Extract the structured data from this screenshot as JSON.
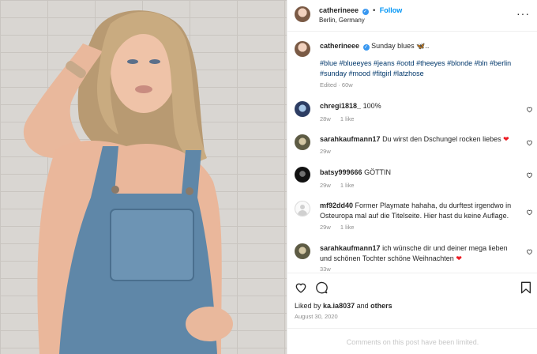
{
  "post": {
    "username": "catherineee",
    "verified_mark": "✓",
    "separator": "•",
    "follow_label": "Follow",
    "location": "Berlin, Germany",
    "more_icon": "more-horizontal-icon",
    "caption_text": "Sunday blues",
    "caption_emoji": "🦋",
    "caption_tail": "..",
    "hashtags": "#blue #blueeyes #jeans #ootd #theeyes #blonde #bln #berlin #sunday #mood #fitgirl #latzhose",
    "edited": "Edited · 60w"
  },
  "comments": [
    {
      "user": "chregi1818_",
      "text": "100%",
      "time": "28w",
      "likes": "1 like",
      "avatar": "blue"
    },
    {
      "user": "sarahkaufmann17",
      "text": "Du wirst den Dschungel rocken liebes",
      "emoji": "❤",
      "time": "29w",
      "avatar": "olive"
    },
    {
      "user": "batsy999666",
      "text": "GÖTTIN",
      "time": "29w",
      "likes": "1 like",
      "avatar": "dark"
    },
    {
      "user": "mf92dd40",
      "text": "Former Playmate hahaha, du durftest irgendwo in Osteuropa mal auf die Titelseite. Hier hast du keine Auflage.",
      "time": "29w",
      "likes": "1 like",
      "avatar": "default"
    },
    {
      "user": "sarahkaufmann17",
      "text": "ich wünsche dir und deiner mega lieben und schönen Tochter schöne Weihnachten",
      "emoji": "❤",
      "time": "33w",
      "avatar": "olive"
    }
  ],
  "actions": {
    "like_icon": "heart-icon",
    "comment_icon": "comment-icon",
    "save_icon": "bookmark-icon"
  },
  "likes": {
    "prefix": "Liked by",
    "user": "ka.ia8037",
    "and": "and",
    "others": "others"
  },
  "date": "August 30, 2020",
  "comments_limited": "Comments on this post have been limited."
}
